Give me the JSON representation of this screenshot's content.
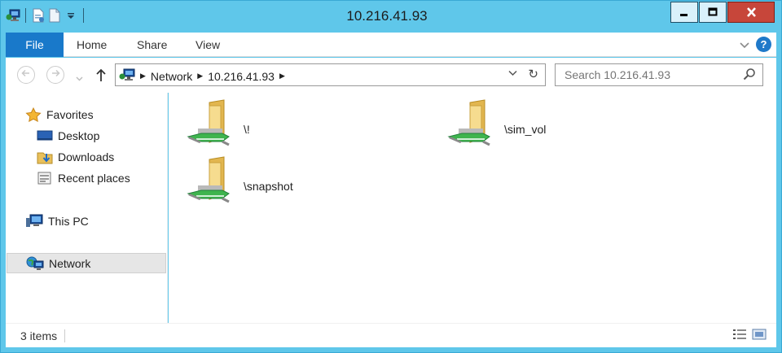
{
  "window": {
    "title": "10.216.41.93"
  },
  "ribbon": {
    "tabs": [
      "File",
      "Home",
      "Share",
      "View"
    ]
  },
  "address": {
    "crumbs": [
      "Network",
      "10.216.41.93"
    ]
  },
  "search": {
    "placeholder": "Search 10.216.41.93"
  },
  "nav": {
    "favorites": "Favorites",
    "items": [
      "Desktop",
      "Downloads",
      "Recent places"
    ],
    "this_pc": "This PC",
    "network": "Network"
  },
  "shares": [
    "\\!",
    "\\sim_vol",
    "\\snapshot"
  ],
  "status": {
    "count": "3 items"
  },
  "icons": {
    "title_app": "network-computer-icon",
    "favorites": "star-icon",
    "desktop": "desktop-icon",
    "downloads": "downloads-folder-icon",
    "recent": "recent-places-icon",
    "this_pc": "computer-icon",
    "network": "network-globe-icon",
    "share": "network-share-folder-icon"
  },
  "colors": {
    "frame": "#5fc7ea",
    "file_tab": "#1979ca",
    "close": "#c7463a"
  }
}
